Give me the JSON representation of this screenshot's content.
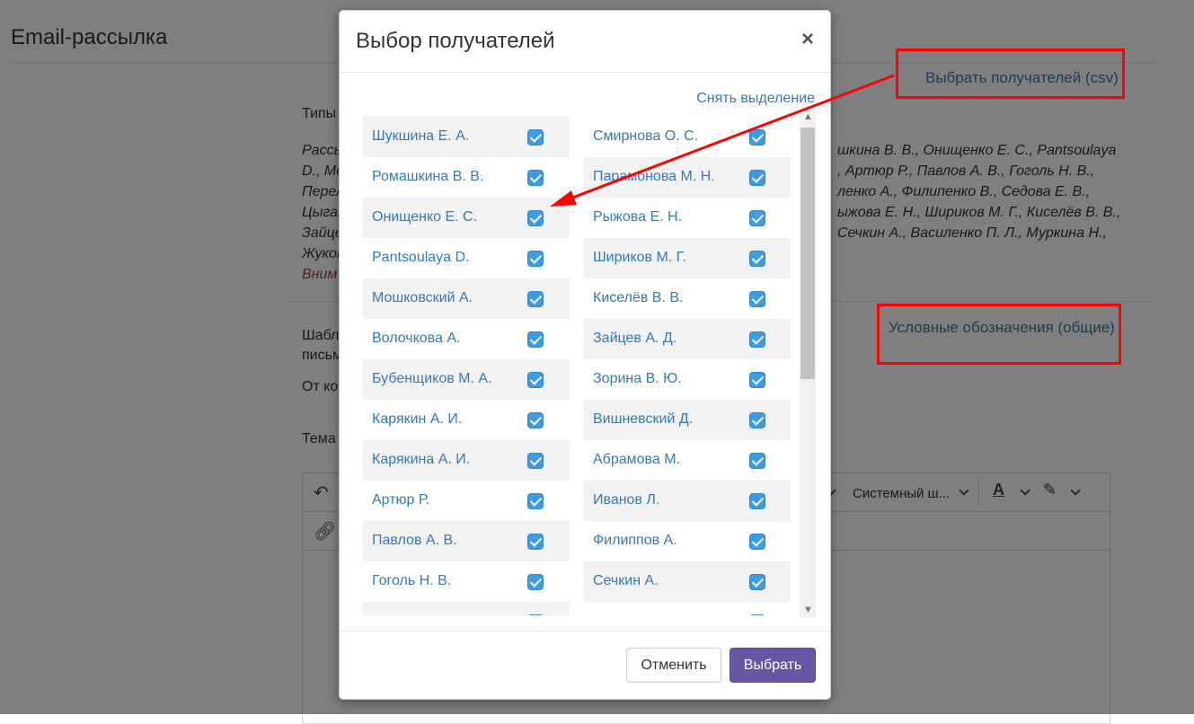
{
  "page": {
    "title": "Email-рассылка",
    "csv_link": "Выбрать получателей (csv)",
    "legend_link": "Условные обозначения (общие)",
    "types_label": "Типы",
    "recipients_prefix_lines": [
      "Рассы",
      "D., Mo",
      "Перел",
      "Цыган",
      "Зайце",
      "Жуков"
    ],
    "recipients_suffix_lines": [
      "шкина В. В., Онищенко Е. С., Pantsoulaya",
      ", Артюр Р., Павлов А. В., Гоголь Н. В.,",
      "ленко А., Филипенко В., Седова Е. В.,",
      "ыжова Е. Н., Шириков М. Г., Киселёв В. В.,",
      "Сечкин А., Василенко П. Л., Муркина Н.,"
    ],
    "warning_prefix": "Вним",
    "template_label_1": "Шабл",
    "template_label_2": "письм",
    "from_label": "От ко",
    "subject_label": "Тема",
    "editor": {
      "font_select": "Системный ш...",
      "undo_icon": "undo-icon",
      "link_icon": "link-icon",
      "text_color_icon": "text-color-icon",
      "highlight_icon": "highlight-icon"
    }
  },
  "modal": {
    "title": "Выбор получателей",
    "close_label": "×",
    "deselect_label": "Снять выделение",
    "left_column": [
      {
        "name": "Шукшина Е. А.",
        "checked": true
      },
      {
        "name": "Ромашкина В. В.",
        "checked": true
      },
      {
        "name": "Онищенко Е. С.",
        "checked": true
      },
      {
        "name": "Pantsoulaya D.",
        "checked": true
      },
      {
        "name": "Мошковский А.",
        "checked": true
      },
      {
        "name": "Волочкова А.",
        "checked": true
      },
      {
        "name": "Бубенщиков М. А.",
        "checked": true
      },
      {
        "name": "Карякин А. И.",
        "checked": true
      },
      {
        "name": "Карякина А. И.",
        "checked": true
      },
      {
        "name": "Артюр Р.",
        "checked": true
      },
      {
        "name": "Павлов А. В.",
        "checked": true
      },
      {
        "name": "Гоголь Н. В.",
        "checked": true
      }
    ],
    "right_column": [
      {
        "name": "Смирнова О. С.",
        "checked": true
      },
      {
        "name": "Парамонова М. Н.",
        "checked": true
      },
      {
        "name": "Рыжова Е. Н.",
        "checked": true
      },
      {
        "name": "Шириков М. Г.",
        "checked": true
      },
      {
        "name": "Киселёв В. В.",
        "checked": true
      },
      {
        "name": "Зайцев А. Д.",
        "checked": true
      },
      {
        "name": "Зорина В. Ю.",
        "checked": true
      },
      {
        "name": "Вишневский Д.",
        "checked": true
      },
      {
        "name": "Абрамова М.",
        "checked": true
      },
      {
        "name": "Иванов Л.",
        "checked": true
      },
      {
        "name": "Филиппов А.",
        "checked": true
      },
      {
        "name": "Сечкин А.",
        "checked": true
      }
    ],
    "cancel_label": "Отменить",
    "select_label": "Выбрать"
  },
  "colors": {
    "link": "#337ab7",
    "primary_button": "#6a55a4",
    "checkbox": "#3d9be4",
    "annotation": "#ff0000"
  }
}
